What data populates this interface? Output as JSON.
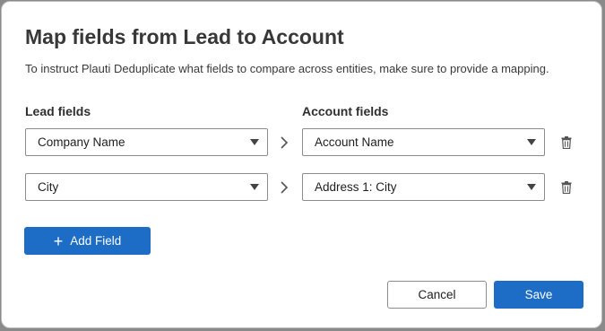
{
  "dialog": {
    "title": "Map fields from Lead to Account",
    "description": "To instruct Plauti Deduplicate what fields to compare across entities, make sure to provide a mapping."
  },
  "columns": {
    "source_label": "Lead fields",
    "target_label": "Account fields"
  },
  "mappings": [
    {
      "source": "Company Name",
      "target": "Account Name"
    },
    {
      "source": "City",
      "target": "Address 1: City"
    }
  ],
  "buttons": {
    "add_field": "Add Field",
    "cancel": "Cancel",
    "save": "Save"
  },
  "icons": {
    "plus": "+",
    "chevron": "chevron-right-icon",
    "trash": "trash-icon",
    "caret": "caret-down-icon"
  },
  "colors": {
    "primary": "#1d6cc5"
  }
}
